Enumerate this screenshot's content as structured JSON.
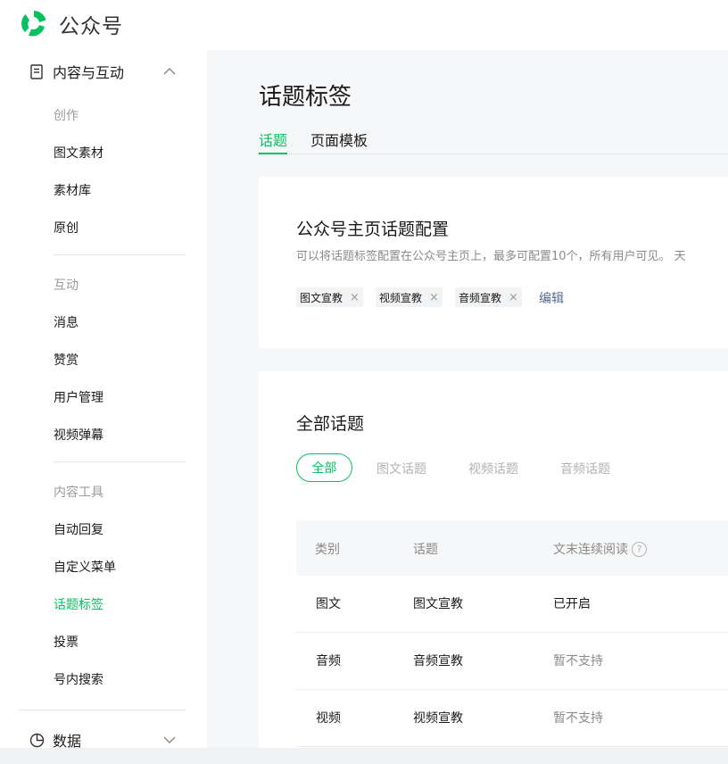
{
  "header": {
    "brand": "公众号"
  },
  "sidebar": {
    "group_content": {
      "label": "内容与互动"
    },
    "section_create": "创作",
    "create_items": [
      "图文素材",
      "素材库",
      "原创"
    ],
    "section_interact": "互动",
    "interact_items": [
      "消息",
      "赞赏",
      "用户管理",
      "视频弹幕"
    ],
    "section_tools": "内容工具",
    "tool_items": [
      "自动回复",
      "自定义菜单",
      "话题标签",
      "投票",
      "号内搜索"
    ],
    "active_item": "话题标签",
    "group_data": {
      "label": "数据"
    }
  },
  "main": {
    "title": "话题标签",
    "tabs": [
      {
        "label": "话题",
        "active": true
      },
      {
        "label": "页面模板",
        "active": false
      }
    ],
    "homepage_config": {
      "title": "公众号主页话题配置",
      "description": "可以将话题标签配置在公众号主页上，最多可配置10个，所有用户可见。 天",
      "tags": [
        "图文宣教",
        "视频宣教",
        "音频宣教"
      ],
      "tag_close": "×",
      "edit_label": "编辑"
    },
    "all_topics": {
      "title": "全部话题",
      "filters": [
        "全部",
        "图文话题",
        "视频话题",
        "音频话题"
      ],
      "active_filter": "全部",
      "columns": [
        "类别",
        "话题",
        "文末连续阅读"
      ],
      "help_glyph": "?",
      "rows": [
        {
          "category": "图文",
          "topic": "图文宣教",
          "continuous_read": "已开启"
        },
        {
          "category": "音频",
          "topic": "音频宣教",
          "continuous_read": "暂不支持"
        },
        {
          "category": "视频",
          "topic": "视频宣教",
          "continuous_read": "暂不支持"
        }
      ]
    }
  },
  "colors": {
    "accent": "#07c160",
    "link": "#576b95",
    "muted": "#8a8a8a"
  },
  "icons": [
    "wechat-logo-icon",
    "document-icon",
    "chevron-up-icon",
    "pie-chart-icon",
    "chevron-down-icon",
    "close-icon",
    "help-icon"
  ]
}
